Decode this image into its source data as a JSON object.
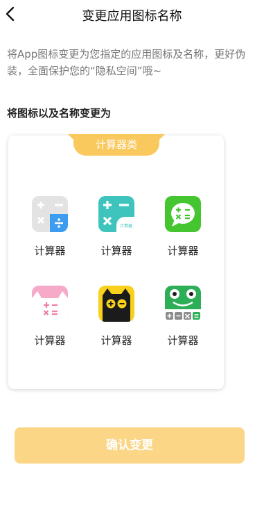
{
  "header": {
    "title": "变更应用图标名称"
  },
  "description": "将App图标变更为您指定的应用图标及名称，更好伪装，全面保护您的“隐私空间”哦~",
  "section_title": "将图标以及名称变更为",
  "category": {
    "tag": "计算器类"
  },
  "icons": [
    {
      "icon": "calculator-gray-icon",
      "label": "计算器"
    },
    {
      "icon": "calculator-teal-icon",
      "label": "计算器",
      "badge": "计算器"
    },
    {
      "icon": "calculator-green-bubble-icon",
      "label": "计算器"
    },
    {
      "icon": "calculator-pink-cat-icon",
      "label": "计算器"
    },
    {
      "icon": "calculator-black-cat-icon",
      "label": "计算器"
    },
    {
      "icon": "calculator-frog-icon",
      "label": "计算器"
    }
  ],
  "confirm_button": "确认变更",
  "colors": {
    "accent": "#f9c95e",
    "button": "#fad686"
  }
}
